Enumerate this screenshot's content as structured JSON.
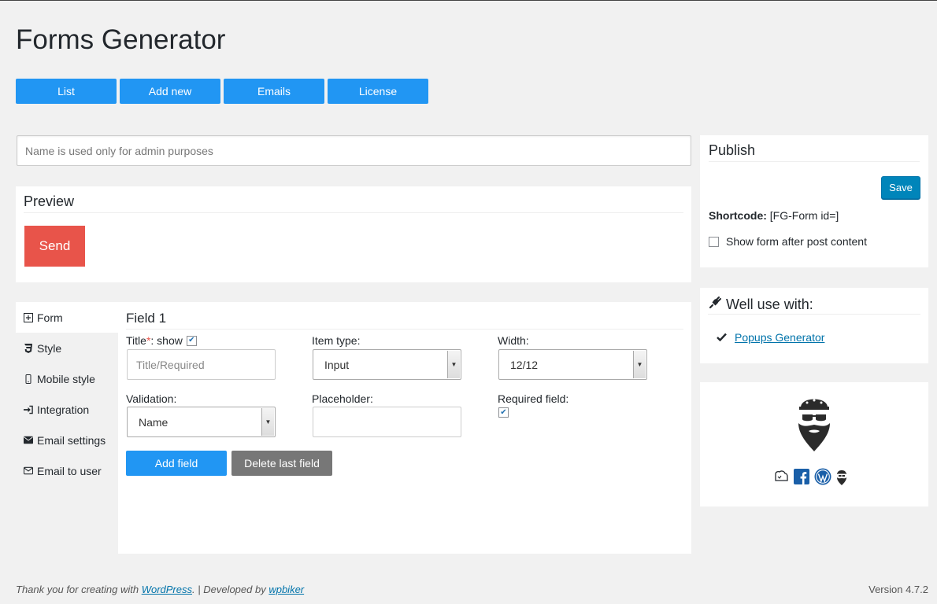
{
  "title": "Forms Generator",
  "topnav": [
    "List",
    "Add new",
    "Emails",
    "License"
  ],
  "name_input": {
    "placeholder": "Name is used only for admin purposes",
    "value": ""
  },
  "preview": {
    "title": "Preview",
    "send_label": "Send"
  },
  "tabs": [
    {
      "label": "Form",
      "icon": "plus-square-icon"
    },
    {
      "label": "Style",
      "icon": "css3-icon"
    },
    {
      "label": "Mobile style",
      "icon": "mobile-icon"
    },
    {
      "label": "Integration",
      "icon": "sign-in-icon"
    },
    {
      "label": "Email settings",
      "icon": "envelope-icon"
    },
    {
      "label": "Email to user",
      "icon": "envelope-outline-icon"
    }
  ],
  "field": {
    "heading": "Field 1",
    "title_label": "Title",
    "required_mark": "*",
    "show_label": ": show",
    "show_checked": true,
    "title_placeholder": "Title/Required",
    "item_type_label": "Item type:",
    "item_type_value": "Input",
    "width_label": "Width:",
    "width_value": "12/12",
    "validation_label": "Validation:",
    "validation_value": "Name",
    "placeholder_label": "Placeholder:",
    "placeholder_value": "",
    "required_label": "Required field:",
    "required_checked": true,
    "add_field": "Add field",
    "delete_field": "Delete last field"
  },
  "publish": {
    "title": "Publish",
    "save_label": "Save",
    "shortcode_label": "Shortcode:",
    "shortcode_value": " [FG-Form id=]",
    "show_after_label": "Show form after post content",
    "show_after_checked": false
  },
  "well_use": {
    "title": "Well use with:",
    "link": "Popups Generator"
  },
  "footer": {
    "thanks_prefix": "Thank you for creating with ",
    "wp_link": "WordPress",
    "dev_prefix": ". | Developed by ",
    "dev_link": "wpbiker",
    "version": "Version 4.7.2"
  },
  "colors": {
    "primary": "#2196f3",
    "send": "#e8544a",
    "gray_button": "#777777",
    "save": "#0085ba",
    "link": "#0073aa"
  }
}
